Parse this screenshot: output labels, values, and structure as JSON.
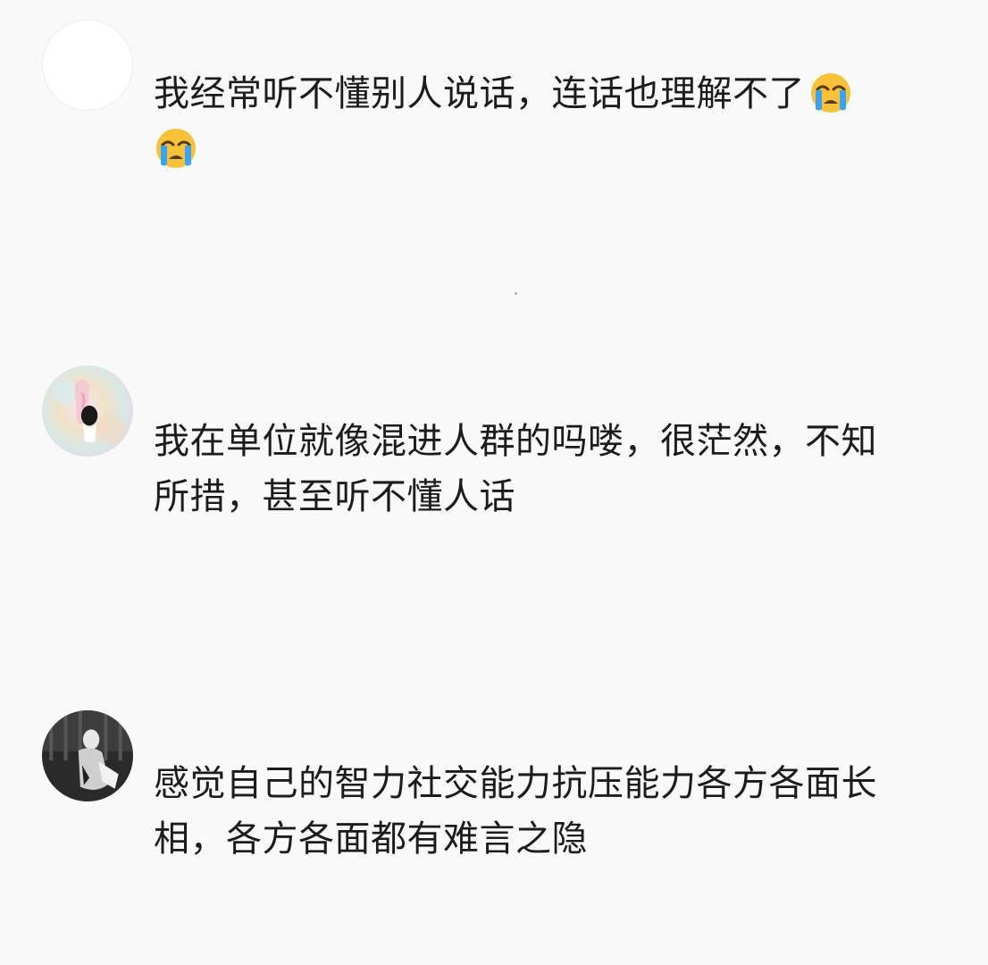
{
  "comments": [
    {
      "text": "我经常听不懂别人说话，连话也理解不了",
      "emojis": [
        "crying-face-icon",
        "crying-face-icon"
      ],
      "avatar": "blank-avatar"
    },
    {
      "text": "我在单位就像混进人群的吗喽，很茫然，不知所措，甚至听不懂人话",
      "avatar": "pastel-holographic-avatar"
    },
    {
      "text": "感觉自己的智力社交能力抗压能力各方各面长相，各方各面都有难言之隐",
      "avatar": "dark-photo-avatar"
    }
  ],
  "colors": {
    "background": "#f9f9f9",
    "text": "#1c1c1c",
    "emoji_face": "#f7c23a",
    "emoji_tear": "#3ba3f0"
  }
}
